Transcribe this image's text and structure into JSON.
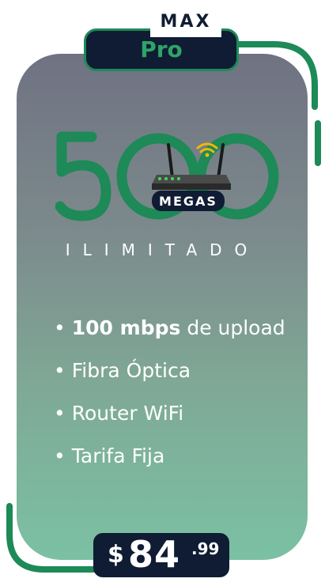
{
  "tier": "MAX",
  "plan": "Pro",
  "headline": {
    "number": "500",
    "badge": "MEGAS"
  },
  "tagline": "ILIMITADO",
  "features": [
    {
      "bold": "100 mbps",
      "rest": " de upload"
    },
    {
      "bold": "",
      "rest": "Fibra Óptica"
    },
    {
      "bold": "",
      "rest": "Router WiFi"
    },
    {
      "bold": "",
      "rest": "Tarifa Fija"
    }
  ],
  "price": {
    "currency": "$",
    "amount": "84",
    "cents": ".99"
  },
  "colors": {
    "green": "#1d8a57",
    "navy": "#0f1c33",
    "wifi": "#f2b705"
  }
}
